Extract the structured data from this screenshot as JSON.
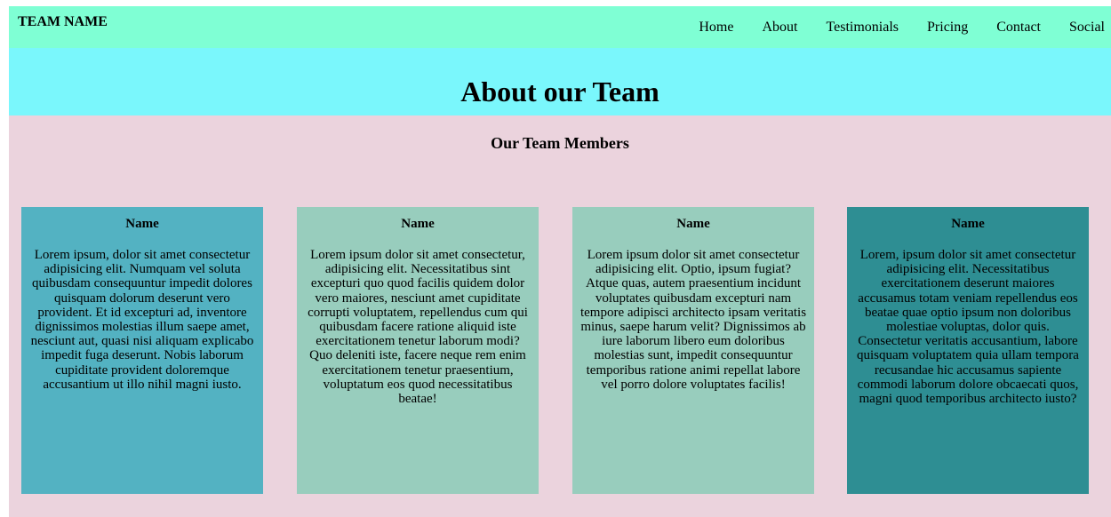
{
  "header": {
    "brand": "TEAM NAME",
    "nav": [
      "Home",
      "About",
      "Testimonials",
      "Pricing",
      "Contact",
      "Social"
    ]
  },
  "hero": {
    "title": "About our Team"
  },
  "main": {
    "section_title": "Our Team Members",
    "cards": [
      {
        "name": "Name",
        "text": "Lorem ipsum, dolor sit amet consectetur adipisicing elit. Numquam vel soluta quibusdam consequuntur impedit dolores quisquam dolorum deserunt vero provident. Et id excepturi ad, inventore dignissimos molestias illum saepe amet, nesciunt aut, quasi nisi aliquam explicabo impedit fuga deserunt. Nobis laborum cupiditate provident doloremque accusantium ut illo nihil magni iusto.",
        "color": "#53b2c2"
      },
      {
        "name": "Name",
        "text": "Lorem ipsum dolor sit amet consectetur, adipisicing elit. Necessitatibus sint excepturi quo quod facilis quidem dolor vero maiores, nesciunt amet cupiditate corrupti voluptatem, repellendus cum qui quibusdam facere ratione aliquid iste exercitationem tenetur laborum modi? Quo deleniti iste, facere neque rem enim exercitationem tenetur praesentium, voluptatum eos quod necessitatibus beatae!",
        "color": "#98cdbd"
      },
      {
        "name": "Name",
        "text": "Lorem ipsum dolor sit amet consectetur adipisicing elit. Optio, ipsum fugiat? Atque quas, autem praesentium incidunt voluptates quibusdam excepturi nam tempore adipisci architecto ipsam veritatis minus, saepe harum velit? Dignissimos ab iure laborum libero eum doloribus molestias sunt, impedit consequuntur temporibus ratione animi repellat labore vel porro dolore voluptates facilis!",
        "color": "#98cdbd"
      },
      {
        "name": "Name",
        "text": "Lorem, ipsum dolor sit amet consectetur adipisicing elit. Necessitatibus exercitationem deserunt maiores accusamus totam veniam repellendus eos beatae quae optio ipsum non doloribus molestiae voluptas, dolor quis. Consectetur veritatis accusantium, labore quisquam voluptatem quia ullam tempora recusandae hic accusamus sapiente commodi laborum dolore obcaecati quos, magni quod temporibus architecto iusto?",
        "color": "#2e8e93"
      }
    ]
  },
  "colors": {
    "navbar": "#7fffd4",
    "hero": "#7af7fc",
    "content": "#ebd3dd"
  }
}
